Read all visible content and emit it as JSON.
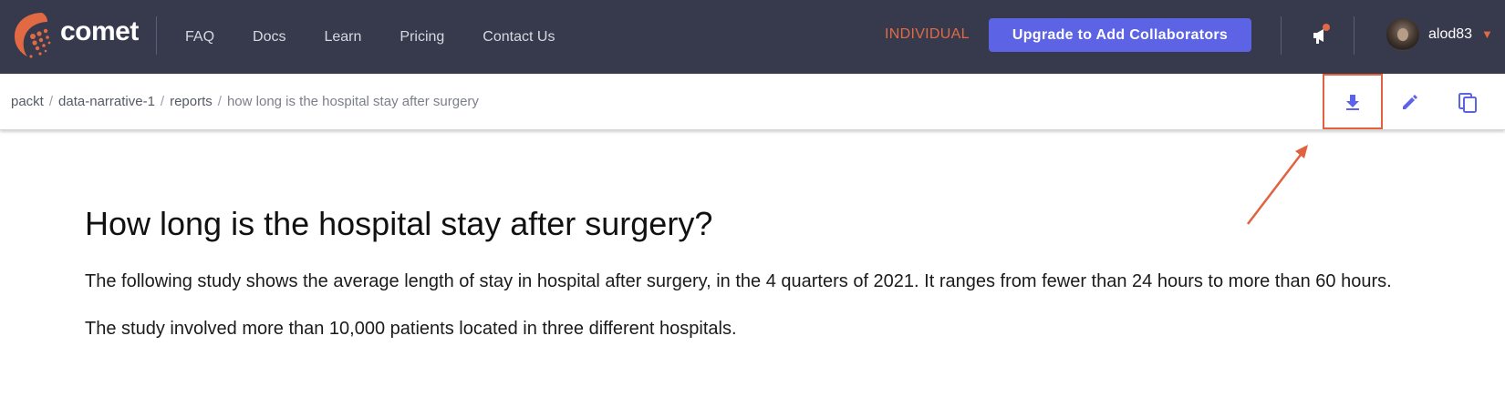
{
  "header": {
    "logo_text": "comet",
    "nav": [
      "FAQ",
      "Docs",
      "Learn",
      "Pricing",
      "Contact Us"
    ],
    "plan_label": "INDIVIDUAL",
    "upgrade_label": "Upgrade to Add Collaborators",
    "username": "alod83",
    "accent_color": "#e16a45",
    "button_color": "#5c63e5",
    "icons": {
      "notification": "megaphone-icon",
      "user_menu": "chevron-down-icon"
    }
  },
  "toolbar": {
    "breadcrumb": [
      "packt",
      "data-narrative-1",
      "reports",
      "how long is the hospital stay after surgery"
    ],
    "separator": "/",
    "icons": [
      "download-icon",
      "edit-icon",
      "copy-icon"
    ],
    "icon_color": "#5c63e5"
  },
  "report": {
    "title": "How long is the hospital stay after surgery?",
    "paragraphs": [
      "The following study shows the average length of stay in hospital after surgery, in the 4 quarters of 2021. It ranges from fewer than 24 hours to more than 60 hours.",
      "The study involved more than 10,000 patients located in three different hospitals."
    ]
  },
  "annotation": {
    "color": "#e0623f",
    "target": "download-icon"
  }
}
